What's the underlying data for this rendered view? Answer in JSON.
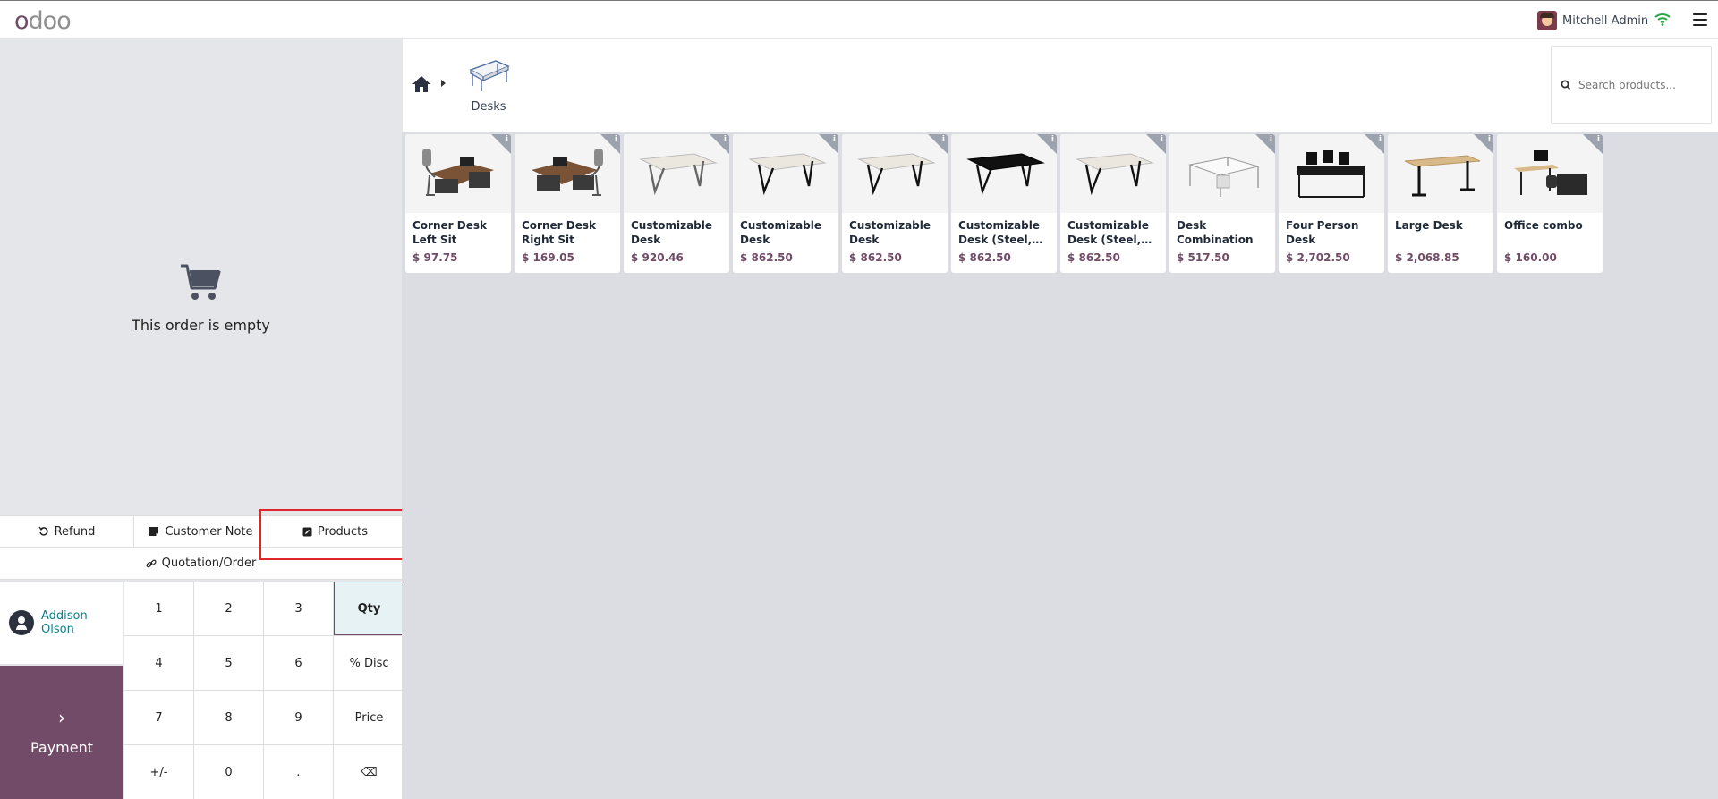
{
  "header": {
    "logo": {
      "first": "o",
      "rest": "doo"
    },
    "user_name": "Mitchell Admin"
  },
  "order": {
    "empty_text": "This order is empty"
  },
  "controls": {
    "refund": "Refund",
    "customer_note": "Customer Note",
    "products": "Products",
    "quotation": "Quotation/Order"
  },
  "customer": {
    "name": "Addison Olson"
  },
  "payment": {
    "label": "Payment"
  },
  "numpad": {
    "keys": [
      "1",
      "2",
      "3",
      "Qty",
      "4",
      "5",
      "6",
      "% Disc",
      "7",
      "8",
      "9",
      "Price",
      "+/-",
      "0",
      ".",
      "⌫"
    ]
  },
  "category": {
    "label": "Desks"
  },
  "search": {
    "placeholder": "Search products..."
  },
  "products": [
    {
      "name": "Corner Desk Left Sit",
      "price": "$ 97.75"
    },
    {
      "name": "Corner Desk Right Sit",
      "price": "$ 169.05"
    },
    {
      "name": "Customizable Desk (Aluminiu…",
      "price": "$ 920.46"
    },
    {
      "name": "Customizable Desk (Custom,…",
      "price": "$ 862.50"
    },
    {
      "name": "Customizable Desk (Custom,…",
      "price": "$ 862.50"
    },
    {
      "name": "Customizable Desk (Steel,…",
      "price": "$ 862.50"
    },
    {
      "name": "Customizable Desk (Steel,…",
      "price": "$ 862.50"
    },
    {
      "name": "Desk Combination",
      "price": "$ 517.50"
    },
    {
      "name": "Four Person Desk",
      "price": "$ 2,702.50"
    },
    {
      "name": "Large Desk",
      "price": "$ 2,068.85"
    },
    {
      "name": "Office combo",
      "price": "$ 160.00"
    }
  ],
  "colors": {
    "brand": "#714B67",
    "customer_link": "#0b7f8a",
    "highlight": "#e0262b"
  }
}
